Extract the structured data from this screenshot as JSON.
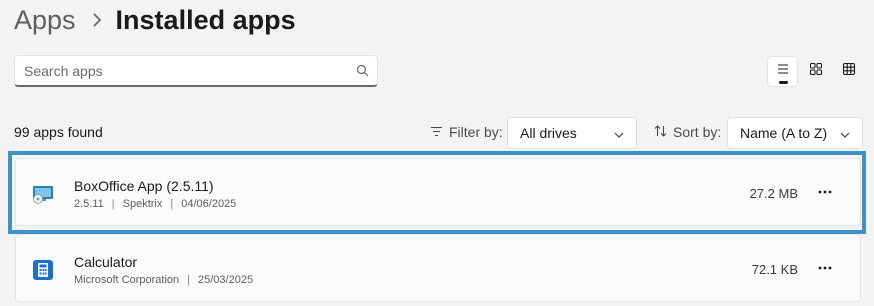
{
  "breadcrumb": {
    "parent": "Apps",
    "current": "Installed apps"
  },
  "search": {
    "placeholder": "Search apps",
    "value": ""
  },
  "view_modes": [
    {
      "name": "list-view",
      "active": true
    },
    {
      "name": "grid-view",
      "active": false
    },
    {
      "name": "tile-view",
      "active": false
    }
  ],
  "results": {
    "count_text": "99 apps found"
  },
  "filter": {
    "label": "Filter by:",
    "selected": "All drives"
  },
  "sort": {
    "label": "Sort by:",
    "selected": "Name (A to Z)"
  },
  "apps": [
    {
      "name": "BoxOffice App (2.5.11)",
      "version": "2.5.11",
      "publisher": "Spektrix",
      "date": "04/06/2025",
      "size": "27.2 MB",
      "icon": "boxoffice-icon",
      "selected": true
    },
    {
      "name": "Calculator",
      "version": "",
      "publisher": "Microsoft Corporation",
      "date": "25/03/2025",
      "size": "72.1 KB",
      "icon": "calculator-icon",
      "selected": false
    }
  ],
  "colors": {
    "selection_border": "#3d93c4",
    "calculator_blue": "#1a6fd1"
  }
}
